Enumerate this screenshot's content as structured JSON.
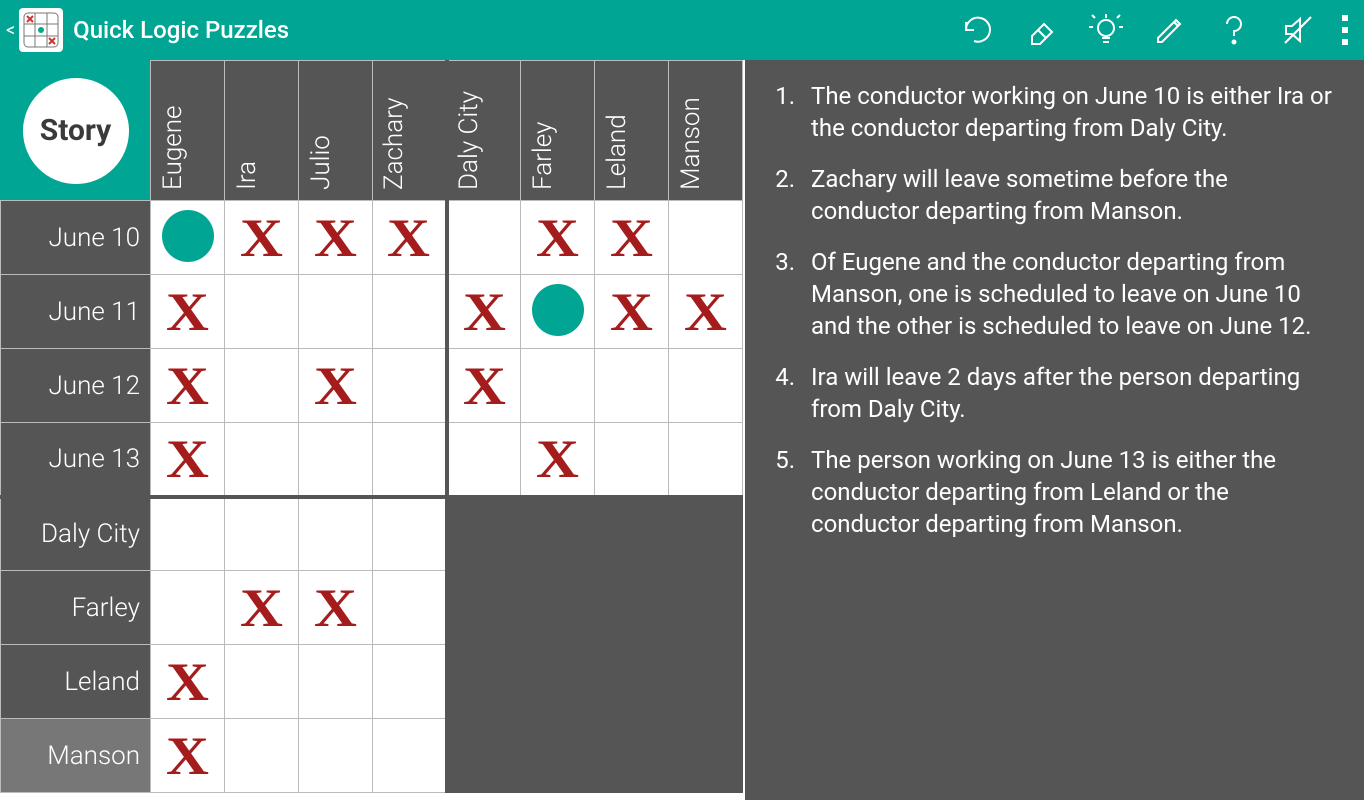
{
  "app": {
    "title": "Quick Logic Puzzles",
    "back_glyph": "<"
  },
  "story_button": "Story",
  "cols_group1": [
    "Eugene",
    "Ira",
    "Julio",
    "Zachary"
  ],
  "cols_group2": [
    "Daly City",
    "Farley",
    "Leland",
    "Manson"
  ],
  "rows_group1": [
    "June 10",
    "June 11",
    "June 12",
    "June 13"
  ],
  "rows_group2": [
    "Daly City",
    "Farley",
    "Leland",
    "Manson"
  ],
  "marks": {
    "r0": [
      "O",
      "X",
      "X",
      "X",
      "",
      "X",
      "X",
      ""
    ],
    "r1": [
      "X",
      "",
      "",
      "",
      "X",
      "O",
      "X",
      "X"
    ],
    "r2": [
      "X",
      "",
      "X",
      "",
      "X",
      "",
      "",
      ""
    ],
    "r3": [
      "X",
      "",
      "",
      "",
      "",
      "X",
      "",
      ""
    ],
    "r4": [
      "",
      "",
      "",
      ""
    ],
    "r5": [
      "",
      "X",
      "X",
      ""
    ],
    "r6": [
      "X",
      "",
      "",
      ""
    ],
    "r7": [
      "X",
      "",
      "",
      ""
    ]
  },
  "clues": [
    "The conductor working on June 10 is either Ira or the conductor departing from Daly City.",
    "Zachary will leave sometime before the conductor departing from Manson.",
    "Of Eugene and the conductor departing from Manson, one is scheduled to leave on June 10 and the other is scheduled to leave on June 12.",
    "Ira will leave 2 days after the person departing from Daly City.",
    "The person working on June 13 is either the conductor departing from Leland or the conductor departing from Manson."
  ],
  "colors": {
    "accent": "#00a693",
    "panel": "#555555",
    "x": "#a51c1c"
  }
}
